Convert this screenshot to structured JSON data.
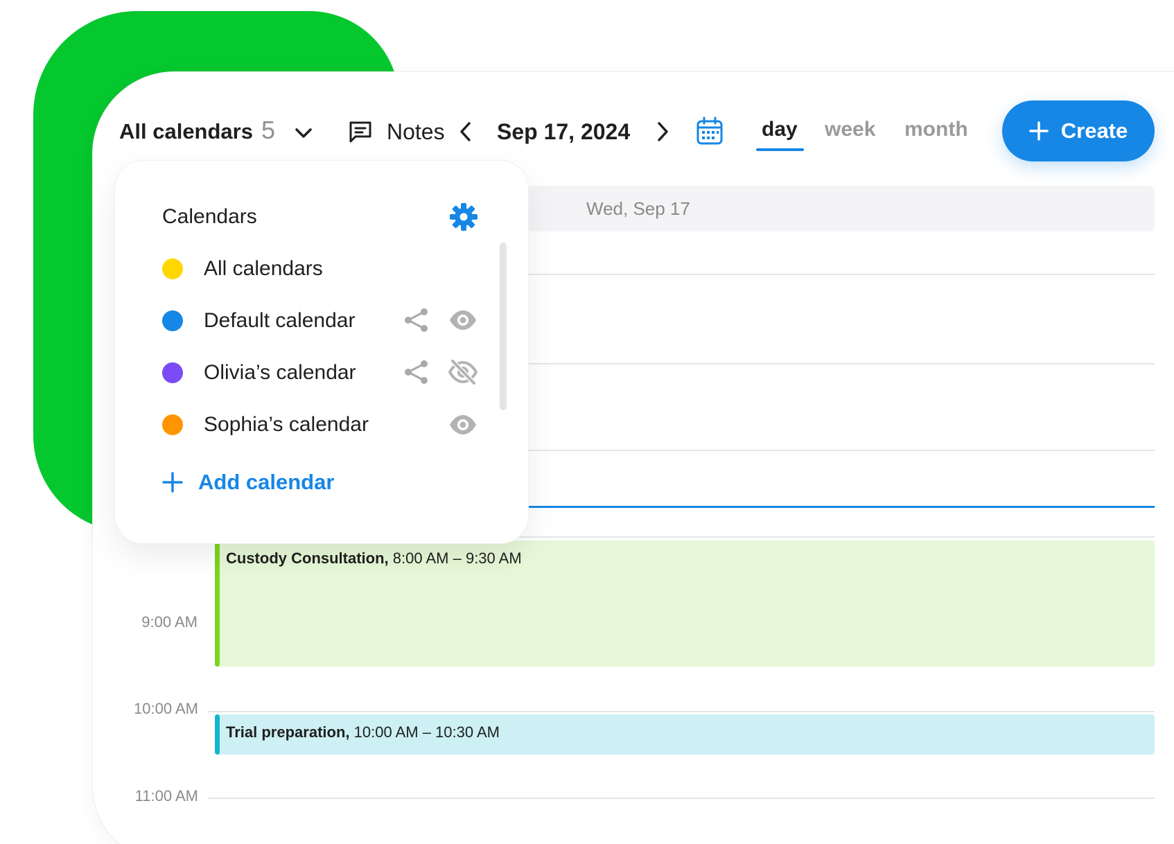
{
  "colors": {
    "brand_green": "#05C72E",
    "accent_blue": "#1687E5",
    "now_line": "#1687E5"
  },
  "toolbar": {
    "calendar_selector_label": "All calendars",
    "calendar_count": "5",
    "notes_label": "Notes",
    "current_date": "Sep 17, 2024",
    "views": [
      {
        "label": "day",
        "active": true
      },
      {
        "label": "week",
        "active": false
      },
      {
        "label": "month",
        "active": false
      }
    ],
    "create_label": "Create",
    "icons": {
      "selector": "chevron-down-icon",
      "notes": "message-square-icon",
      "prev": "chevron-left-icon",
      "next": "chevron-right-icon",
      "date_picker": "calendar-icon",
      "create": "plus-icon"
    }
  },
  "day_view": {
    "header_label": "Wed, Sep 17",
    "time_labels": [
      "9:00 AM",
      "10:00 AM",
      "11:00 AM"
    ],
    "events": [
      {
        "title": "Custody Consultation,",
        "time": "8:00 AM – 9:30 AM",
        "color": "#7ED321",
        "bg": "#E6F8D7"
      },
      {
        "title": "Trial preparation,",
        "time": "10:00 AM – 10:30 AM",
        "color": "#12B5D0",
        "bg": "#CCF0F4"
      }
    ]
  },
  "calendars_panel": {
    "title": "Calendars",
    "settings_icon": "gear-icon",
    "items": [
      {
        "label": "All calendars",
        "color": "#FFD600",
        "share": false,
        "visibility": "none"
      },
      {
        "label": "Default calendar",
        "color": "#1687E5",
        "share": true,
        "visibility": "visible"
      },
      {
        "label": "Olivia’s calendar",
        "color": "#7B4CF5",
        "share": true,
        "visibility": "hidden"
      },
      {
        "label": "Sophia’s calendar",
        "color": "#FF9500",
        "share": false,
        "visibility": "visible"
      }
    ],
    "add_label": "Add calendar"
  }
}
